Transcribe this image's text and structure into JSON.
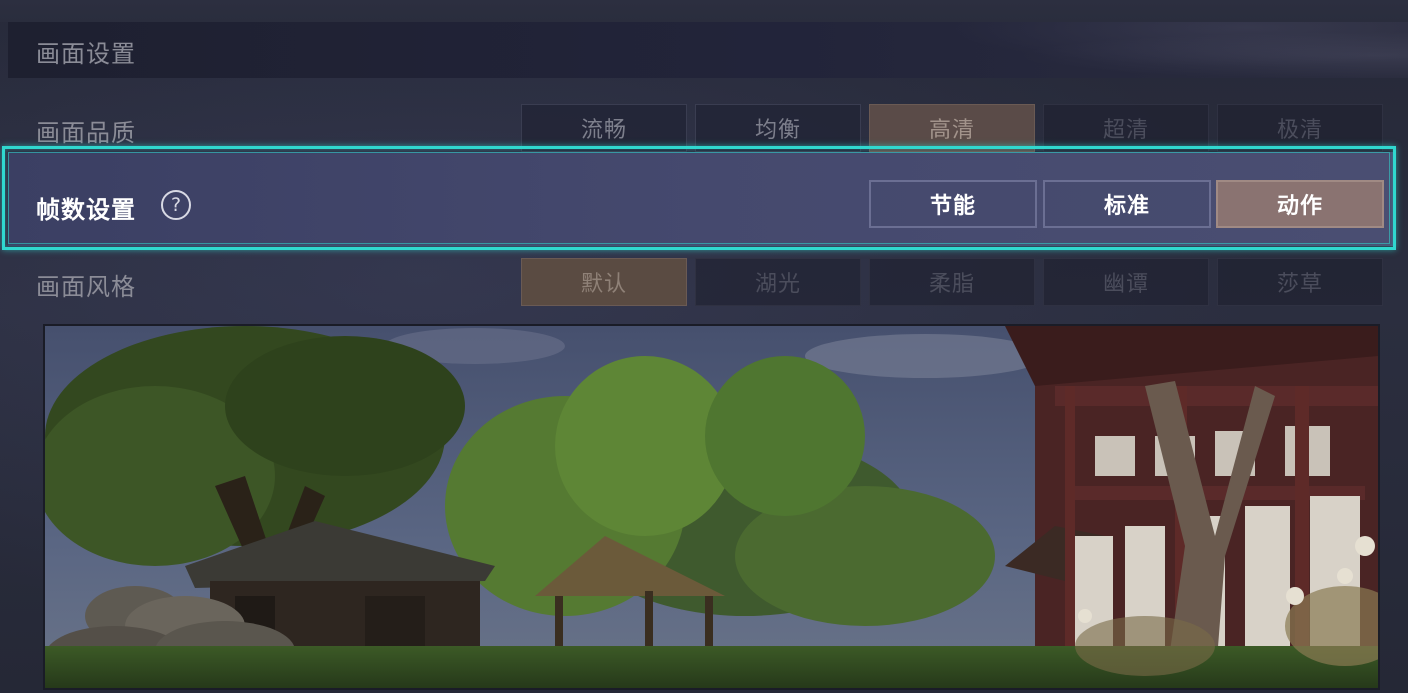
{
  "header": {
    "title": "画面设置"
  },
  "quality": {
    "label": "画面品质",
    "options": [
      "流畅",
      "均衡",
      "高清",
      "超清",
      "极清"
    ],
    "selected": "高清"
  },
  "framerate": {
    "label": "帧数设置",
    "help_icon": "?",
    "options": [
      "节能",
      "标准",
      "动作"
    ],
    "selected": "动作"
  },
  "style": {
    "label": "画面风格",
    "options": [
      "默认",
      "湖光",
      "柔脂",
      "幽谭",
      "莎草"
    ],
    "selected": "默认"
  },
  "colors": {
    "highlight_border": "#30d8cf",
    "selected_option": "#8a7371"
  }
}
